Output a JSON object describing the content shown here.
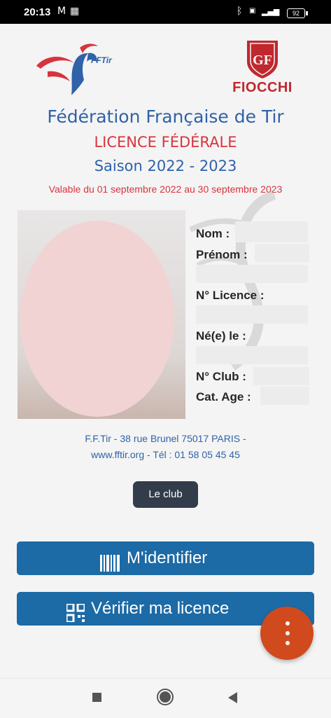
{
  "status_bar": {
    "time": "20:13",
    "battery": "92"
  },
  "logos": {
    "fftir_text": "FFTir",
    "fiocchi_text": "FIOCCHI"
  },
  "header": {
    "federation": "Fédération Française de Tir",
    "licence_type": "LICENCE FÉDÉRALE",
    "season": "Saison 2022 - 2023",
    "validity": "Valable du 01 septembre 2022 au 30 septembre 2023"
  },
  "holder": {
    "nom_label": "Nom :",
    "prenom_label": "Prénom :",
    "licence_label": "N° Licence :",
    "birth_label": "Né(e) le :",
    "club_label": "N° Club :",
    "age_label": "Cat. Age :"
  },
  "footer_address": {
    "line1": "F.F.Tir - 38 rue Brunel 75017 PARIS -",
    "line2": "www.fftir.org - Tél : 01 58 05 45 45"
  },
  "buttons": {
    "club": "Le club",
    "identify": "M'identifier",
    "verify": "Vérifier ma licence"
  },
  "colors": {
    "primary_blue": "#1c6aa6",
    "title_blue": "#2f62a8",
    "accent_red": "#d8343d",
    "fab_orange": "#d04a1e",
    "club_button": "#323c4a"
  },
  "icons": {
    "identify": "barcode-icon",
    "verify": "qr-code-icon",
    "fab": "more-vert-icon"
  }
}
